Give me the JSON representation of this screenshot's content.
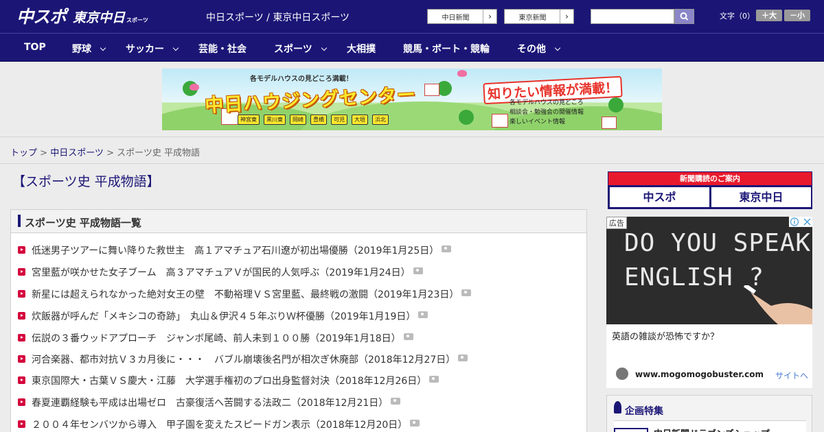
{
  "header": {
    "logo_main": "中スポ",
    "logo_sub": "東京中日",
    "logo_small": "スポーツ",
    "site_title": "中日スポーツ / 東京中日スポーツ",
    "paper_buttons": [
      "中日新聞",
      "東京新聞"
    ],
    "search_placeholder": "",
    "font_size_label": "文字（0）",
    "font_bigger": "＋大",
    "font_smaller": "－小"
  },
  "nav": [
    "TOP",
    "野球",
    "サッカー",
    "芸能・社会",
    "スポーツ",
    "大相撲",
    "競馬・ボート・競輪",
    "その他"
  ],
  "banner": {
    "top": "各モデルハウスの見どころ満載！",
    "main": "中日ハウジングセンター",
    "right": "知りたい情報が満載！",
    "info": [
      "各モデルハウスの見どころ",
      "相談会・勉強会の開催情報",
      "楽しいイベント情報"
    ],
    "cities": [
      "神宮東",
      "黒川東",
      "岡崎",
      "豊橋",
      "可児",
      "大垣",
      "浜北"
    ]
  },
  "breadcrumb": {
    "top": "トップ",
    "sep": " > ",
    "parent": "中日スポーツ",
    "current": "スポーツ史 平成物語"
  },
  "page_title": "【スポーツ史 平成物語】",
  "list": {
    "heading": "スポーツ史 平成物語一覧",
    "articles": [
      "低迷男子ツアーに舞い降りた救世主　高１アマチュア石川遼が初出場優勝（2019年1月25日）",
      "宮里藍が咲かせた女子ブーム　高３アマチュアＶが国民的人気呼ぶ（2019年1月24日）",
      "新星には超えられなかった絶対女王の壁　不動裕理ＶＳ宮里藍、最終戦の激闘（2019年1月23日）",
      "炊飯器が呼んだ「メキシコの奇跡」　丸山＆伊沢４５年ぶりＷ杯優勝（2019年1月19日）",
      "伝説の３番ウッドアプローチ　ジャンボ尾崎、前人未到１００勝（2019年1月18日）",
      "河合楽器、都市対抗Ｖ３カ月後に・・・　バブル崩壊後名門が相次ぎ休廃部（2018年12月27日）",
      "東京国際大・古葉ＶＳ慶大・江藤　大学選手権初のプロ出身監督対決（2018年12月26日）",
      "春夏連覇経験も平成は出場ゼロ　古豪復活へ苦闘する法政二（2018年12月21日）",
      "２００４年センバツから導入　甲子園を変えたスピードガン表示（2018年12月20日）"
    ]
  },
  "sidebar": {
    "subscribe_title": "新聞購読のご案内",
    "subscribe_logos": [
      "中スポ",
      "東京中日"
    ],
    "ad_badge": "広告",
    "ad_image_text": [
      "DO YOU SPEAK",
      "ENGLISH ?"
    ],
    "ad_caption": "英語の雑談が恐怖ですか？",
    "ad_domain": "www.mogomogobuster.com",
    "ad_link": "サイトへ",
    "feature_title": "企画特集",
    "feature_item": "中日新聞ドラゴンズショップ"
  }
}
